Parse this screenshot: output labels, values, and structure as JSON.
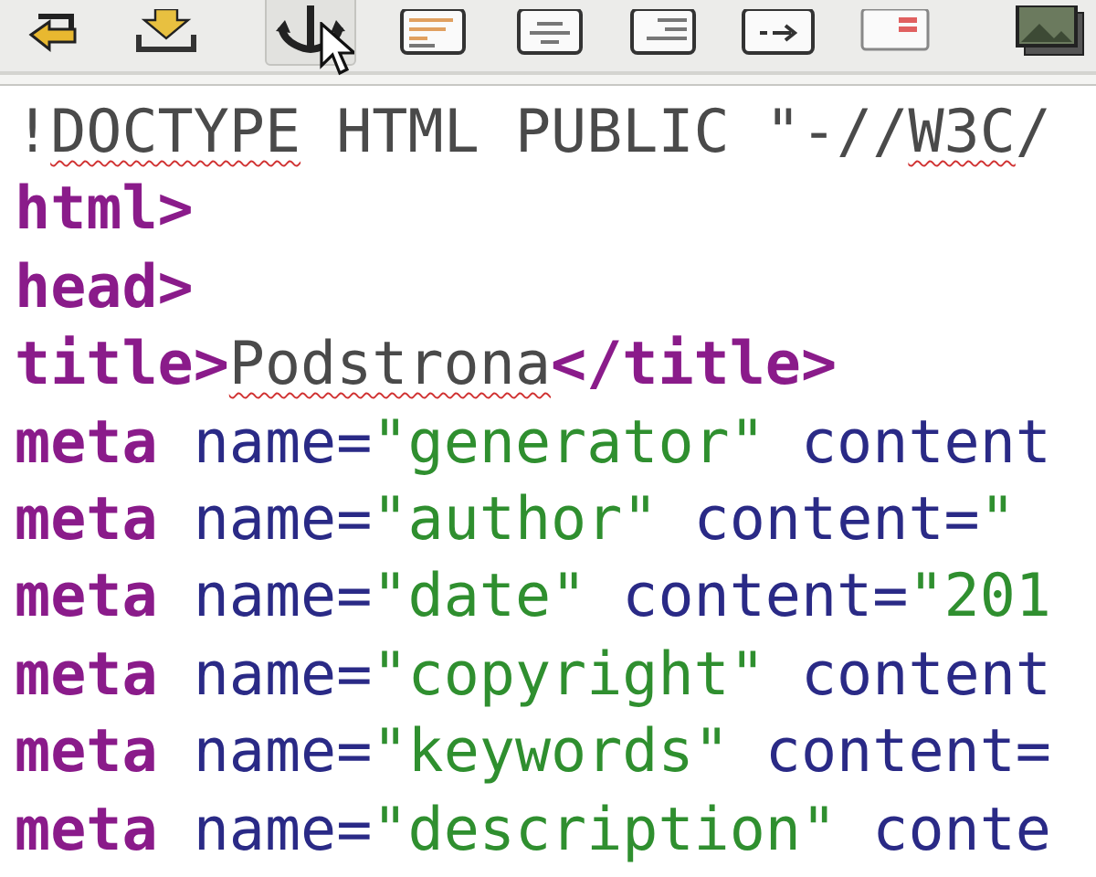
{
  "toolbar": {
    "buttons": [
      {
        "pressed": false
      },
      {
        "pressed": false
      },
      {
        "pressed": true
      },
      {
        "pressed": false
      },
      {
        "pressed": false
      },
      {
        "pressed": false
      },
      {
        "pressed": false
      },
      {
        "pressed": false
      },
      {
        "pressed": false
      }
    ]
  },
  "editor": {
    "lines": [
      [
        {
          "kind": "doctype",
          "text": "!",
          "misspelled": false
        },
        {
          "kind": "doctype",
          "text": "DOCTYPE",
          "misspelled": true
        },
        {
          "kind": "doctype",
          "text": " HTML PUBLIC \"-//",
          "misspelled": false
        },
        {
          "kind": "doctype",
          "text": "W3C",
          "misspelled": true
        },
        {
          "kind": "doctype",
          "text": "/",
          "misspelled": false
        }
      ],
      [
        {
          "kind": "tag",
          "text": "html>",
          "misspelled": false
        }
      ],
      [
        {
          "kind": "tag",
          "text": "head>",
          "misspelled": false
        }
      ],
      [
        {
          "kind": "tag",
          "text": "title>",
          "misspelled": false
        },
        {
          "kind": "text",
          "text": "Podstrona",
          "misspelled": true
        },
        {
          "kind": "tag",
          "text": "</title>",
          "misspelled": false
        }
      ],
      [
        {
          "kind": "tag",
          "text": "meta",
          "misspelled": false
        },
        {
          "kind": "attr",
          "text": " name=",
          "misspelled": false
        },
        {
          "kind": "value",
          "text": "\"generator\"",
          "misspelled": false
        },
        {
          "kind": "attr",
          "text": " content",
          "misspelled": false
        }
      ],
      [
        {
          "kind": "tag",
          "text": "meta",
          "misspelled": false
        },
        {
          "kind": "attr",
          "text": " name=",
          "misspelled": false
        },
        {
          "kind": "value",
          "text": "\"author\"",
          "misspelled": false
        },
        {
          "kind": "attr",
          "text": " content=",
          "misspelled": false
        },
        {
          "kind": "value",
          "text": "\"",
          "misspelled": false
        }
      ],
      [
        {
          "kind": "tag",
          "text": "meta",
          "misspelled": false
        },
        {
          "kind": "attr",
          "text": " name=",
          "misspelled": false
        },
        {
          "kind": "value",
          "text": "\"date\"",
          "misspelled": false
        },
        {
          "kind": "attr",
          "text": " content=",
          "misspelled": false
        },
        {
          "kind": "value",
          "text": "\"201",
          "misspelled": false
        }
      ],
      [
        {
          "kind": "tag",
          "text": "meta",
          "misspelled": false
        },
        {
          "kind": "attr",
          "text": " name=",
          "misspelled": false
        },
        {
          "kind": "value",
          "text": "\"copyright\"",
          "misspelled": false
        },
        {
          "kind": "attr",
          "text": " content",
          "misspelled": false
        }
      ],
      [
        {
          "kind": "tag",
          "text": "meta",
          "misspelled": false
        },
        {
          "kind": "attr",
          "text": " name=",
          "misspelled": false
        },
        {
          "kind": "value",
          "text": "\"keywords\"",
          "misspelled": false
        },
        {
          "kind": "attr",
          "text": " content=",
          "misspelled": false
        }
      ],
      [
        {
          "kind": "tag",
          "text": "meta",
          "misspelled": false
        },
        {
          "kind": "attr",
          "text": " name=",
          "misspelled": false
        },
        {
          "kind": "value",
          "text": "\"description\"",
          "misspelled": false
        },
        {
          "kind": "attr",
          "text": " conte",
          "misspelled": false
        }
      ]
    ]
  }
}
